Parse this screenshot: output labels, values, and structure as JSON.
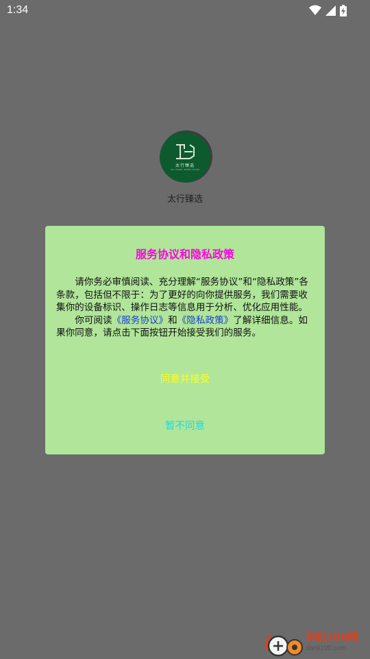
{
  "status_bar": {
    "time": "1:34",
    "icons": [
      "wifi-icon",
      "cellular-signal-icon",
      "battery-charging-icon"
    ]
  },
  "splash": {
    "app_name": "太行臻选",
    "logo_text": "太行臻选",
    "logo_sub": "TAI HANG ZHEN XUAN",
    "logo_color": "#0e5a2f"
  },
  "dialog": {
    "title": "服务协议和隐私政策",
    "paragraph1": "请你务必审慎阅读、充分理解“服务协议”和“隐私政策”各条款，包括但不限于：为了更好的向你提供服务，我们需要收集你的设备标识、操作日志等信息用于分析、优化应用性能。",
    "p2_prefix": "你可阅读",
    "link_service": "《服务协议》",
    "p2_and": "和",
    "link_privacy": "《隐私政策》",
    "p2_suffix": "了解详细信息。如果你同意，请点击下面按钮开始接受我们的服务。",
    "accept_label": "同意并接受",
    "decline_label": "暂不同意",
    "colors": {
      "background": "#b0e59a",
      "title": "#ff00e6",
      "link": "#1a3ed1",
      "accept": "#ffff1a",
      "decline": "#1ddbe0"
    }
  },
  "watermark": {
    "title": "单机100网",
    "url": "danji100.com"
  }
}
